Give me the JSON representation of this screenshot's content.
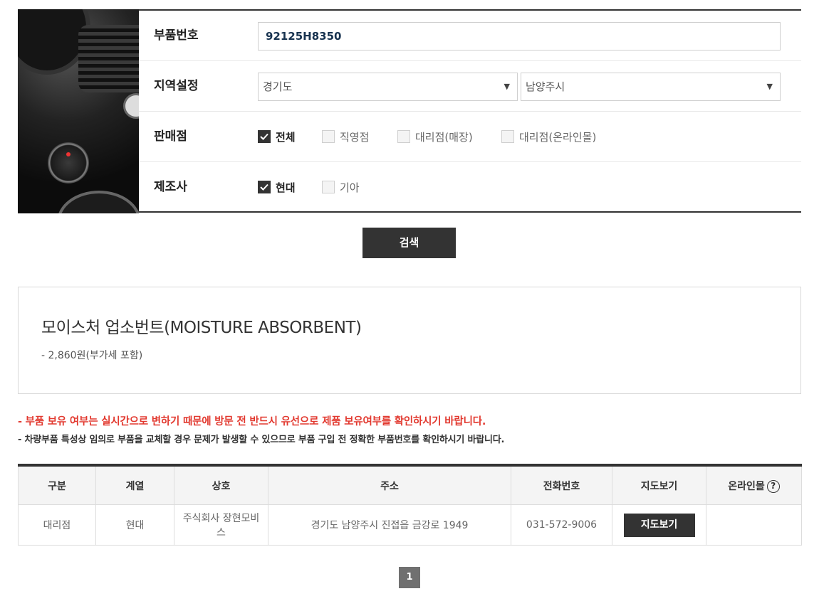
{
  "form": {
    "part_number_label": "부품번호",
    "part_number_value": "92125H8350",
    "region_label": "지역설정",
    "region_province": "경기도",
    "region_city": "남양주시",
    "seller_label": "판매점",
    "sellers": [
      {
        "label": "전체",
        "checked": true
      },
      {
        "label": "직영점",
        "checked": false
      },
      {
        "label": "대리점(매장)",
        "checked": false
      },
      {
        "label": "대리점(온라인몰)",
        "checked": false
      }
    ],
    "maker_label": "제조사",
    "makers": [
      {
        "label": "현대",
        "checked": true
      },
      {
        "label": "기아",
        "checked": false
      }
    ],
    "search_button": "검색"
  },
  "product": {
    "name": "모이스처 업소번트(MOISTURE ABSORBENT)",
    "price": "- 2,860원(부가세 포함)"
  },
  "notices": {
    "line1": "- 부품 보유 여부는 실시간으로 변하기 때문에 방문 전 반드시 유선으로 제품 보유여부를 확인하시기 바랍니다.",
    "line2": "- 차량부품 특성상 임의로 부품을 교체할 경우 문제가 발생할 수 있으므로 부품 구입 전 정확한 부품번호를 확인하시기 바랍니다."
  },
  "table": {
    "headers": [
      "구분",
      "계열",
      "상호",
      "주소",
      "전화번호",
      "지도보기",
      "온라인몰"
    ],
    "help_icon": "?",
    "rows": [
      {
        "type": "대리점",
        "brand": "현대",
        "name": "주식회사 장현모비스",
        "address": "경기도 남양주시 진접읍 금강로 1949",
        "phone": "031-572-9006",
        "map_button": "지도보기",
        "online": ""
      }
    ]
  },
  "pagination": {
    "current": "1"
  },
  "colors": {
    "dark": "#333333",
    "notice_red": "#e2392f",
    "page_gray": "#707070"
  }
}
